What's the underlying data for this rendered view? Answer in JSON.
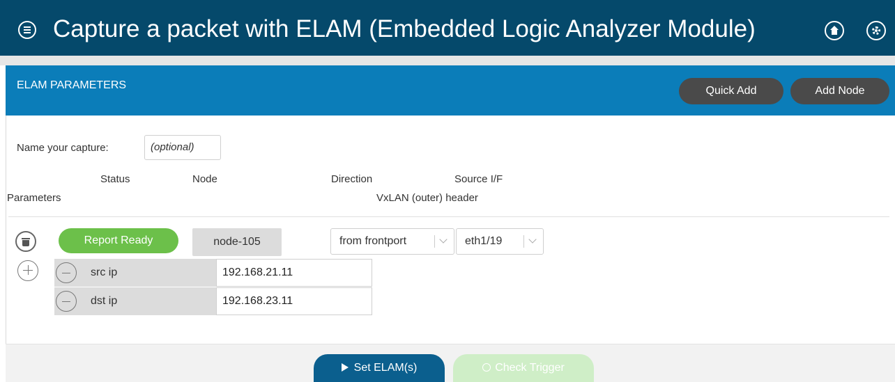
{
  "header": {
    "title": "Capture a packet with ELAM (Embedded Logic Analyzer Module)",
    "menu_icon": "menu-icon",
    "home_icon": "home-icon",
    "settings_icon": "gear-icon"
  },
  "panel": {
    "title": "ELAM PARAMETERS",
    "quick_add_label": "Quick Add",
    "add_node_label": "Add Node"
  },
  "capture_name": {
    "label": "Name your capture:",
    "placeholder": "(optional)"
  },
  "columns": {
    "status": "Status",
    "node": "Node",
    "direction": "Direction",
    "source_if": "Source I/F",
    "parameters": "Parameters",
    "vxlan_header": "VxLAN (outer) header"
  },
  "node_row": {
    "status": "Report Ready",
    "node": "node-105",
    "direction": "from frontport",
    "source_if": "eth1/19"
  },
  "parameters": [
    {
      "name": "src ip",
      "value": "192.168.21.11"
    },
    {
      "name": "dst ip",
      "value": "192.168.23.11"
    }
  ],
  "footer": {
    "set_label": "Set ELAM(s)",
    "check_label": "Check Trigger"
  },
  "colors": {
    "topbar": "#05496b",
    "panel_header": "#0b7db9",
    "status_ready": "#6cc04a",
    "primary_button": "#0b5f8e",
    "disabled_button": "#cfeec7"
  }
}
